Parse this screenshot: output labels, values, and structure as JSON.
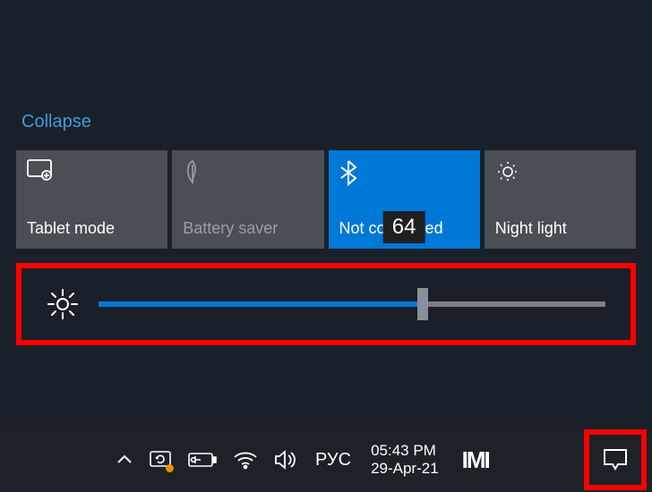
{
  "collapse_label": "Collapse",
  "tiles": [
    {
      "label": "Tablet mode"
    },
    {
      "label": "Battery saver"
    },
    {
      "label": "Not connected"
    },
    {
      "label": "Night light"
    }
  ],
  "brightness": {
    "value": 64,
    "percent": 64
  },
  "tray": {
    "lang": "РУС",
    "time": "05:43 PM",
    "date": "29-Apr-21",
    "app": "IMI"
  }
}
